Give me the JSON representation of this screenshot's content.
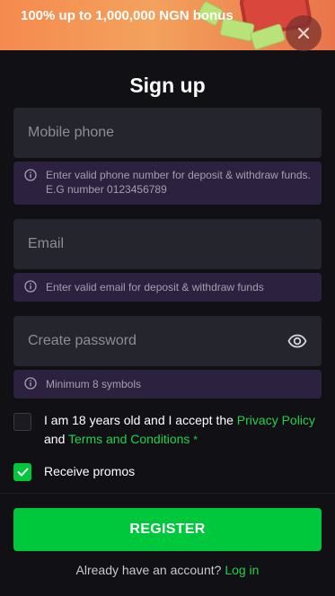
{
  "banner": {
    "text": "100% up to 1,000,000 NGN bonus",
    "close_icon": "close-icon"
  },
  "title": "Sign up",
  "fields": {
    "phone": {
      "placeholder": "Mobile phone",
      "hint": "Enter valid phone number for deposit & withdraw funds. E.G number 0123456789"
    },
    "email": {
      "placeholder": "Email",
      "hint": "Enter valid email for deposit & withdraw funds"
    },
    "password": {
      "placeholder": "Create password",
      "hint": "Minimum 8 symbols",
      "toggle_icon": "eye-icon"
    }
  },
  "consent": {
    "text_prefix": "I am 18 years old and I accept the",
    "privacy_link": "Privacy Policy",
    "and": "and",
    "terms_link": "Terms and Conditions",
    "required_mark": "*",
    "checked": false
  },
  "promos": {
    "label": "Receive promos",
    "checked": true
  },
  "register_button": "REGISTER",
  "login_prompt": {
    "text": "Already have an account?",
    "link": "Log in"
  },
  "colors": {
    "accent": "#00c83c",
    "link": "#1fd348",
    "background": "#111015",
    "field": "#25252d",
    "hint": "#2d2140",
    "banner": "#f3a25d"
  }
}
